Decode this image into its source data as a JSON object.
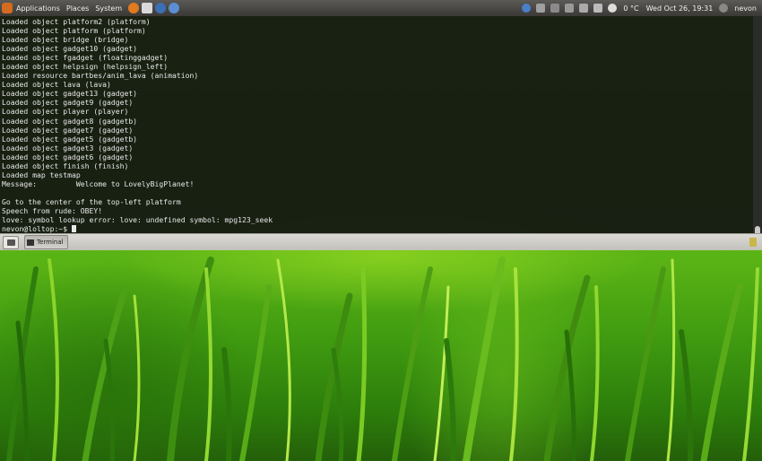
{
  "top_panel": {
    "menus": [
      "Applications",
      "Places",
      "System"
    ],
    "weather": "0 °C",
    "clock": "Wed Oct 26, 19:31",
    "user": "nevon"
  },
  "terminal": {
    "lines": [
      "Loaded object platform2 (platform)",
      "Loaded object platform (platform)",
      "Loaded object bridge (bridge)",
      "Loaded object gadget10 (gadget)",
      "Loaded object fgadget (floatinggadget)",
      "Loaded object helpsign (helpsign_left)",
      "Loaded resource bartbes/anim_lava (animation)",
      "Loaded object lava (lava)",
      "Loaded object gadget13 (gadget)",
      "Loaded object gadget9 (gadget)",
      "Loaded object player (player)",
      "Loaded object gadget8 (gadgetb)",
      "Loaded object gadget7 (gadget)",
      "Loaded object gadget5 (gadgetb)",
      "Loaded object gadget3 (gadget)",
      "Loaded object gadget6 (gadget)",
      "Loaded object finish (finish)",
      "Loaded map testmap",
      "Message:         Welcome to LovelyBigPlanet!",
      "",
      "Go to the center of the top-left platform",
      "Speech from rude: OBEY!",
      "love: symbol lookup error: love: undefined symbol: mpg123_seek"
    ],
    "prompt": "nevon@loltop:~$ "
  },
  "taskbar": {
    "window_label": "Terminal"
  }
}
